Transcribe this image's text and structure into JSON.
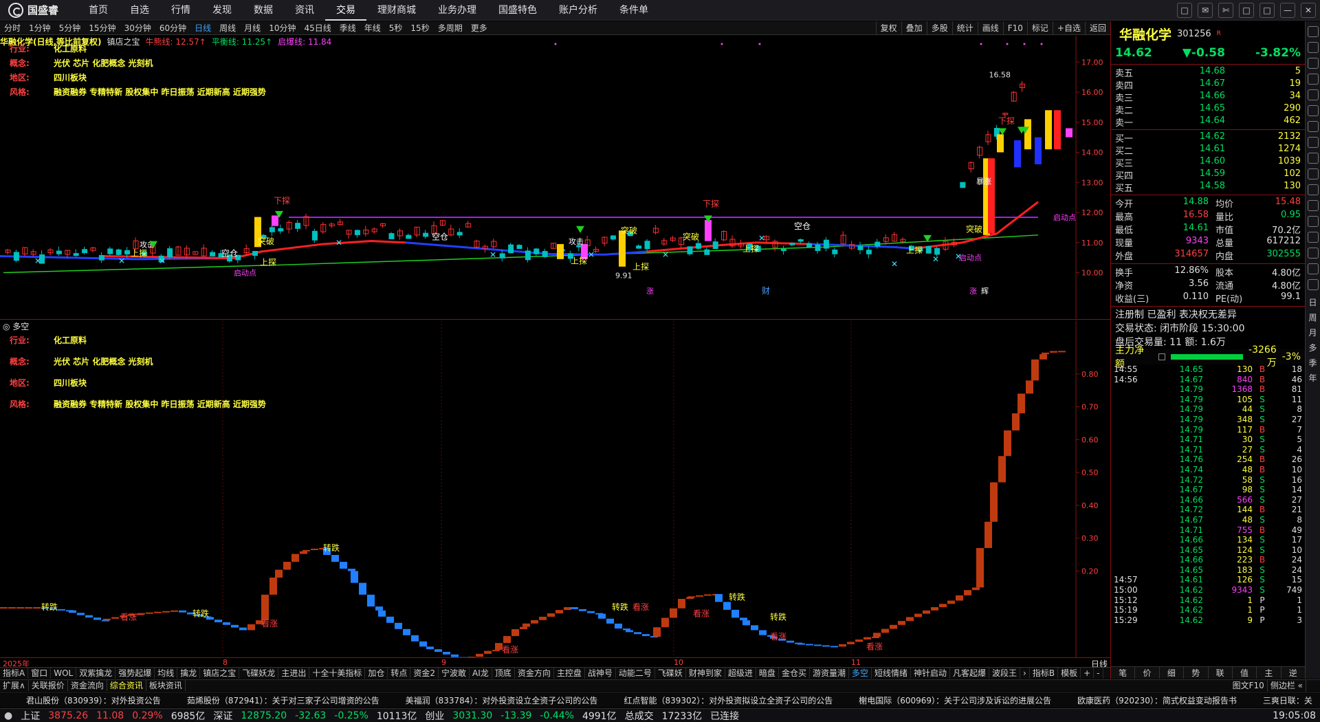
{
  "app": {
    "logo_text": "国盛睿",
    "menu": [
      "首页",
      "自选",
      "行情",
      "发现",
      "数据",
      "资讯",
      "交易",
      "理财商城",
      "业务办理",
      "国盛特色",
      "账户分析",
      "条件单"
    ],
    "active_menu": 6,
    "window_buttons": [
      "□",
      "✉",
      "✄",
      "□",
      "□",
      "—",
      "✕"
    ]
  },
  "periods": [
    "分时",
    "1分钟",
    "5分钟",
    "15分钟",
    "30分钟",
    "60分钟",
    "日线",
    "周线",
    "月线",
    "10分钟",
    "45日线",
    "季线",
    "年线",
    "5秒",
    "15秒",
    "多周期",
    "更多"
  ],
  "active_period": 6,
  "right_tools": [
    "复权",
    "叠加",
    "多股",
    "统计",
    "画线",
    "F10",
    "标记",
    "+自选",
    "返回"
  ],
  "chart_header": {
    "name": "华融化学(日线,等比前复权)",
    "indicator": "镇店之宝",
    "l1_label": "牛熊线: 12.57↑",
    "l2_label": "平衡线: 11.25↑",
    "l3_label": "启爆线: 11.84"
  },
  "info_rows": [
    {
      "k": "行业:",
      "v": "化工原料"
    },
    {
      "k": "概念:",
      "v": "光伏 芯片 化肥概念 光刻机"
    },
    {
      "k": "地区:",
      "v": "四川板块"
    },
    {
      "k": "风格:",
      "v": "融资融券 专精特新 股权集中 昨日振荡 近期新高 近期强势"
    }
  ],
  "sub_header": "多空",
  "main_yaxis": [
    "17.00",
    "16.00",
    "15.00",
    "14.00",
    "13.00",
    "12.00",
    "11.00",
    "10.00"
  ],
  "sub_yaxis": [
    "0.80",
    "0.70",
    "0.60",
    "0.50",
    "0.40",
    "0.30",
    "0.20"
  ],
  "x_labels": [
    "2025年",
    "8",
    "9",
    "10",
    "11"
  ],
  "x_period": "日线",
  "annotations": {
    "high_price": "16.58",
    "low_price": "9.91",
    "launch1": "启动点",
    "launch2": "启动点",
    "launch3": "启动点",
    "kongcang": "空仓",
    "xiatan": "下探",
    "shangtan": "上探",
    "tupo": "突破",
    "gongji": "攻击",
    "baozhang": "暴涨",
    "zhuandie": "转跌",
    "kanzhang": "看涨",
    "cai": "财",
    "zhang": "涨",
    "ji": "辉"
  },
  "stock": {
    "name": "华融化学",
    "code": "301256",
    "flag": "R",
    "price": "14.62",
    "change": "▼-0.58",
    "pct": "-3.82%"
  },
  "orderbook_sell": [
    {
      "l": "卖五",
      "p": "14.68",
      "v": "5"
    },
    {
      "l": "卖四",
      "p": "14.67",
      "v": "19"
    },
    {
      "l": "卖三",
      "p": "14.66",
      "v": "34"
    },
    {
      "l": "卖二",
      "p": "14.65",
      "v": "290"
    },
    {
      "l": "卖一",
      "p": "14.64",
      "v": "462"
    }
  ],
  "orderbook_buy": [
    {
      "l": "买一",
      "p": "14.62",
      "v": "2132"
    },
    {
      "l": "买二",
      "p": "14.61",
      "v": "1274"
    },
    {
      "l": "买三",
      "p": "14.60",
      "v": "1039"
    },
    {
      "l": "买四",
      "p": "14.59",
      "v": "102"
    },
    {
      "l": "买五",
      "p": "14.58",
      "v": "130"
    }
  ],
  "stats": [
    {
      "l1": "今开",
      "v1": "14.88",
      "c1": "g",
      "l2": "均价",
      "v2": "15.48",
      "c2": "r"
    },
    {
      "l1": "最高",
      "v1": "16.58",
      "c1": "r",
      "l2": "量比",
      "v2": "0.95",
      "c2": "g"
    },
    {
      "l1": "最低",
      "v1": "14.61",
      "c1": "g",
      "l2": "市值",
      "v2": "70.2亿",
      "c2": "w"
    },
    {
      "l1": "现量",
      "v1": "9343",
      "c1": "m",
      "l2": "总量",
      "v2": "617212",
      "c2": "w"
    },
    {
      "l1": "外盘",
      "v1": "314657",
      "c1": "r",
      "l2": "内盘",
      "v2": "302555",
      "c2": "g"
    }
  ],
  "stats2": [
    {
      "l1": "换手",
      "v1": "12.86%",
      "c1": "w",
      "l2": "股本",
      "v2": "4.80亿",
      "c2": "w"
    },
    {
      "l1": "净资",
      "v1": "3.56",
      "c1": "w",
      "l2": "流通",
      "v2": "4.80亿",
      "c2": "w"
    },
    {
      "l1": "收益(三)",
      "v1": "0.110",
      "c1": "w",
      "l2": "PE(动)",
      "v2": "99.1",
      "c2": "w"
    }
  ],
  "reg_text": "注册制 已盈利 表决权无差异",
  "trade_status": "交易状态: 闭市阶段 15:30:00",
  "after_hours": "盘后交易量: 11  额: 1.6万",
  "mainflow": {
    "label": "主力净额",
    "value": "-3266万",
    "pct": "-3%"
  },
  "ticks": [
    {
      "t": "14:55",
      "p": "14.65",
      "v": "130",
      "s": "B",
      "n": "18",
      "pc": "g",
      "vc": "y",
      "sc": "r"
    },
    {
      "t": "14:56",
      "p": "14.67",
      "v": "840",
      "s": "B",
      "n": "46",
      "pc": "g",
      "vc": "m",
      "sc": "r"
    },
    {
      "t": "",
      "p": "14.79",
      "v": "1368",
      "s": "B",
      "n": "81",
      "pc": "g",
      "vc": "m",
      "sc": "r"
    },
    {
      "t": "",
      "p": "14.79",
      "v": "105",
      "s": "S",
      "n": "11",
      "pc": "g",
      "vc": "y",
      "sc": "g"
    },
    {
      "t": "",
      "p": "14.79",
      "v": "44",
      "s": "S",
      "n": "8",
      "pc": "g",
      "vc": "y",
      "sc": "g"
    },
    {
      "t": "",
      "p": "14.79",
      "v": "348",
      "s": "S",
      "n": "27",
      "pc": "g",
      "vc": "y",
      "sc": "g"
    },
    {
      "t": "",
      "p": "14.79",
      "v": "117",
      "s": "B",
      "n": "7",
      "pc": "g",
      "vc": "y",
      "sc": "r"
    },
    {
      "t": "",
      "p": "14.71",
      "v": "30",
      "s": "S",
      "n": "5",
      "pc": "g",
      "vc": "y",
      "sc": "g"
    },
    {
      "t": "",
      "p": "14.71",
      "v": "27",
      "s": "S",
      "n": "4",
      "pc": "g",
      "vc": "y",
      "sc": "g"
    },
    {
      "t": "",
      "p": "14.76",
      "v": "254",
      "s": "B",
      "n": "26",
      "pc": "g",
      "vc": "y",
      "sc": "r"
    },
    {
      "t": "",
      "p": "14.74",
      "v": "48",
      "s": "B",
      "n": "10",
      "pc": "g",
      "vc": "y",
      "sc": "r"
    },
    {
      "t": "",
      "p": "14.72",
      "v": "58",
      "s": "S",
      "n": "16",
      "pc": "g",
      "vc": "y",
      "sc": "g"
    },
    {
      "t": "",
      "p": "14.67",
      "v": "98",
      "s": "S",
      "n": "14",
      "pc": "g",
      "vc": "y",
      "sc": "g"
    },
    {
      "t": "",
      "p": "14.66",
      "v": "566",
      "s": "S",
      "n": "27",
      "pc": "g",
      "vc": "m",
      "sc": "g"
    },
    {
      "t": "",
      "p": "14.72",
      "v": "144",
      "s": "B",
      "n": "21",
      "pc": "g",
      "vc": "y",
      "sc": "r"
    },
    {
      "t": "",
      "p": "14.67",
      "v": "48",
      "s": "S",
      "n": "8",
      "pc": "g",
      "vc": "y",
      "sc": "g"
    },
    {
      "t": "",
      "p": "14.71",
      "v": "755",
      "s": "B",
      "n": "49",
      "pc": "g",
      "vc": "m",
      "sc": "r"
    },
    {
      "t": "",
      "p": "14.66",
      "v": "134",
      "s": "S",
      "n": "17",
      "pc": "g",
      "vc": "y",
      "sc": "g"
    },
    {
      "t": "",
      "p": "14.65",
      "v": "124",
      "s": "S",
      "n": "10",
      "pc": "g",
      "vc": "y",
      "sc": "g"
    },
    {
      "t": "",
      "p": "14.66",
      "v": "223",
      "s": "B",
      "n": "24",
      "pc": "g",
      "vc": "y",
      "sc": "r"
    },
    {
      "t": "",
      "p": "14.65",
      "v": "183",
      "s": "S",
      "n": "24",
      "pc": "g",
      "vc": "y",
      "sc": "g"
    },
    {
      "t": "14:57",
      "p": "14.61",
      "v": "126",
      "s": "S",
      "n": "15",
      "pc": "g",
      "vc": "y",
      "sc": "g"
    },
    {
      "t": "15:00",
      "p": "14.62",
      "v": "9343",
      "s": "S",
      "n": "749",
      "pc": "g",
      "vc": "m",
      "sc": "g"
    },
    {
      "t": "15:12",
      "p": "14.62",
      "v": "1",
      "s": "P",
      "n": "1",
      "pc": "g",
      "vc": "y",
      "sc": "w"
    },
    {
      "t": "15:19",
      "p": "14.62",
      "v": "1",
      "s": "P",
      "n": "1",
      "pc": "g",
      "vc": "y",
      "sc": "w"
    },
    {
      "t": "15:29",
      "p": "14.62",
      "v": "9",
      "s": "P",
      "n": "3",
      "pc": "g",
      "vc": "y",
      "sc": "w"
    }
  ],
  "rp_tabs": [
    "笔",
    "价",
    "细",
    "势",
    "联",
    "值",
    "主",
    "逆"
  ],
  "right_sidebar": [
    "日",
    "周",
    "月",
    "多",
    "季",
    "年"
  ],
  "ind_tabs": [
    "指标A",
    "窗口",
    "WOL",
    "双紫擒龙",
    "强势起爆",
    "均线",
    "擒龙",
    "镇店之宝",
    "飞碟妖龙",
    "主进出",
    "十全十美指标",
    "加仓",
    "转点",
    "资金2",
    "宁波敢",
    "AI龙",
    "顶底",
    "资金方向",
    "主控盘",
    "战神号",
    "动能二号",
    "飞碟妖",
    "财神到家",
    "超级进",
    "暗盘",
    "金仓买",
    "游资量潮",
    "多空",
    "短线情绪",
    "神针启动",
    "凡客起爆",
    "波段王",
    "›",
    "指标B",
    "模板",
    "+",
    "-"
  ],
  "active_ind_tab": 27,
  "bottom_tabs": [
    "扩展∧",
    "关联报价",
    "资金流向",
    "综合资讯",
    "板块资讯"
  ],
  "active_bottom_tab": 3,
  "bottom_right": [
    "图文F10",
    "侧边栏 «"
  ],
  "news": [
    "君山股份（830939）：对外投资公告",
    "茹烯股份（872941）：关于对三家子公司增资的公告",
    "美福润（833784）：对外投资设立全资子公司的公告",
    "红点智能（839302）：对外投资拟设立全资子公司的公告",
    "榭电国际（600969）：关于公司涉及诉讼的进展公告",
    "欧康医药（920230）：简式权益变动报告书",
    "三爽日联：关"
  ],
  "status": {
    "sh_label": "上证",
    "sh": "3875.26",
    "sh_chg": "11.08",
    "sh_pct": "0.29%",
    "sh_amt": "6985亿",
    "sz_label": "深证",
    "sz": "12875.20",
    "sz_chg": "-32.63",
    "sz_pct": "-0.25%",
    "sz_amt": "10113亿",
    "cy_label": "创业",
    "cy": "3031.30",
    "cy_chg": "-13.39",
    "cy_pct": "-0.44%",
    "cy_amt": "4991亿",
    "total_label": "总成交",
    "total": "17233亿",
    "conn": "已连接",
    "time": "19:05:08"
  },
  "chart_data": {
    "type": "candlestick",
    "title": "华融化学(日线,等比前复权)",
    "x": [
      "2025年",
      "8",
      "9",
      "10",
      "11"
    ],
    "ylim": [
      9.6,
      17.6
    ],
    "high_marked": 16.58,
    "low_marked": 9.91,
    "last_close": 14.62,
    "sub_indicator": {
      "name": "多空",
      "ylim": [
        0.0,
        0.9
      ]
    }
  }
}
